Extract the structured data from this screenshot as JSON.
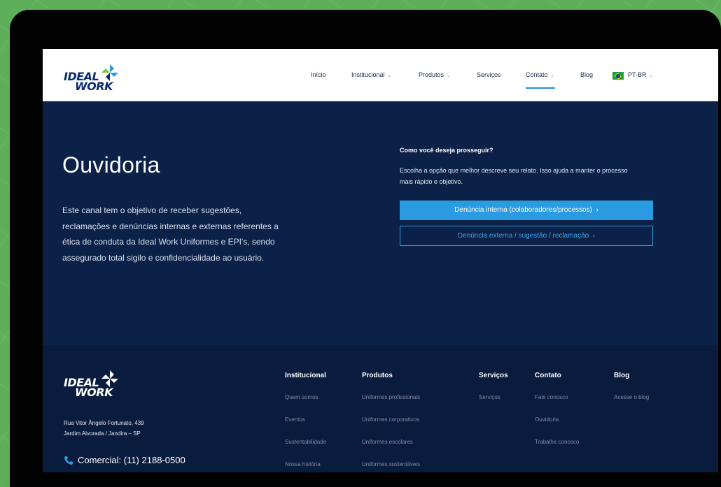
{
  "header": {
    "logo": {
      "line1": "IDEAL",
      "line2": "WORK"
    },
    "nav": [
      {
        "label": "Início",
        "dropdown": false
      },
      {
        "label": "Institucional",
        "dropdown": true
      },
      {
        "label": "Produtos",
        "dropdown": true
      },
      {
        "label": "Serviços",
        "dropdown": false
      },
      {
        "label": "Contato",
        "dropdown": true
      },
      {
        "label": "Blog",
        "dropdown": false
      }
    ],
    "language": "PT-BR"
  },
  "hero": {
    "title": "Ouvidoria",
    "description": "Este canal tem o objetivo de receber sugestões, reclamações e denúncias internas e externas referentes a ética de conduta da Ideal Work Uniformes e EPI's, sendo assegurado total sigilo e confidencialidade ao usuário.",
    "question": "Como você deseja prosseguir?",
    "helper": "Escolha a opção que melhor descreve seu relato. Isso ajuda a manter o processo mais rápido e objetivo.",
    "primary_button": "Denúncia interna (colaboradores/processos)",
    "secondary_button": "Denúncia externa / sugestão / reclamação"
  },
  "footer": {
    "logo": {
      "line1": "IDEAL",
      "line2": "WORK"
    },
    "address_line1": "Rua Vitor Ângelo Fortunato, 439",
    "address_line2": "Jardim Alvorada / Jandira – SP",
    "phone": "Comercial: (11) 2188-0500",
    "columns": [
      {
        "heading": "Institucional",
        "links": [
          "Quem somos",
          "Eventos",
          "Sustentabilidade",
          "Nossa história"
        ]
      },
      {
        "heading": "Produtos",
        "links": [
          "Uniformes profissionais",
          "Uniformes corporativos",
          "Uniformes escolares",
          "Uniformes sustentáveis"
        ]
      },
      {
        "heading": "Serviços",
        "links": [
          "Serviços"
        ]
      },
      {
        "heading": "Contato",
        "links": [
          "Fale conosco",
          "Ouvidoria",
          "Trabalhe conosco"
        ]
      },
      {
        "heading": "Blog",
        "links": [
          "Acesse o blog"
        ]
      }
    ]
  },
  "colors": {
    "brand_navy": "#0b2a72",
    "hero_bg": "#0b2148",
    "footer_bg": "#0a1c3e",
    "accent_blue": "#2a9be0",
    "background_green": "#5fae5a"
  },
  "icons": {
    "logo_mark": "pinwheel-icon",
    "phone": "phone-icon",
    "language_flag": "brazil-flag-icon",
    "chevron": "chevron-down-icon",
    "arrow": "chevron-right-icon"
  }
}
